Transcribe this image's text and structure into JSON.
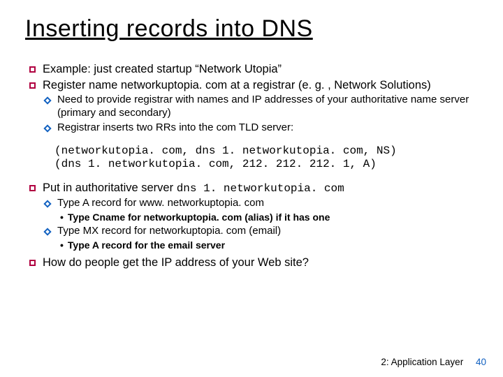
{
  "title": "Inserting records into DNS",
  "b1": "Example: just created startup “Network Utopia”",
  "b2": "Register name networkuptopia. com at a registrar (e. g. , Network Solutions)",
  "b2a": "Need to provide registrar with names and IP addresses of your authoritative name server (primary and secondary)",
  "b2b": "Registrar inserts two RRs into the com TLD server:",
  "code1": "(networkutopia. com, dns 1. networkutopia. com, NS)",
  "code2": "(dns 1. networkutopia. com, 212. 212. 212. 1, A)",
  "b3pre": "Put in authoritative server ",
  "b3mono": "dns 1. networkutopia. com",
  "b3a": "Type A record for www. networkuptopia. com",
  "b3a1": "Type Cname for networkuptopia. com (alias) if it has one",
  "b3b": "Type MX record for networkuptopia. com (email)",
  "b3b1": "Type A record for the email server",
  "b4": "How do people get the IP address of your Web site?",
  "footer_label": "2: Application Layer",
  "footer_page": "40"
}
